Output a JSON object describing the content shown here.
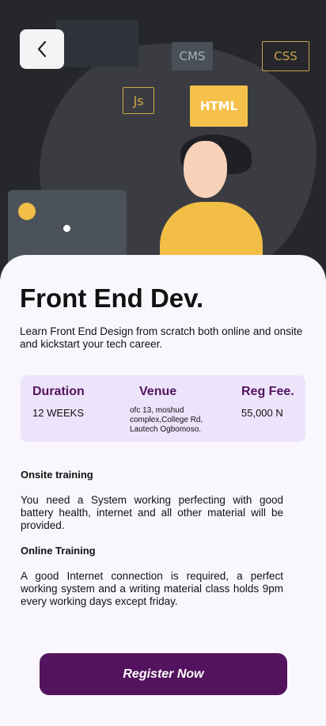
{
  "hero": {
    "tags": {
      "cms": "CMS",
      "css": "CSS",
      "js": "Js",
      "html": "HTML"
    },
    "back_icon": "chevron-left-icon"
  },
  "course": {
    "title": "Front End Dev.",
    "description": "Learn Front End Design from scratch both online and onsite and kickstart your tech career."
  },
  "info": {
    "duration": {
      "label": "Duration",
      "value": "12 WEEKS"
    },
    "venue": {
      "label": "Venue",
      "value": "ofc 13, moshud complex,College Rd, Lautech Ogbomoso."
    },
    "fee": {
      "label": "Reg Fee.",
      "value": "55,000 N"
    }
  },
  "onsite": {
    "heading": "Onsite training",
    "text": "You need a System working perfecting with good battery health, internet and all other material will be provided."
  },
  "online": {
    "heading": "Online Training",
    "text": "A good Internet connection is required, a perfect working system and a writing material class holds 9pm every working days except friday."
  },
  "actions": {
    "register_label": "Register Now"
  },
  "colors": {
    "accent": "#54135e",
    "info_bg": "#ece4fb",
    "card_bg": "#f9f7fd"
  }
}
